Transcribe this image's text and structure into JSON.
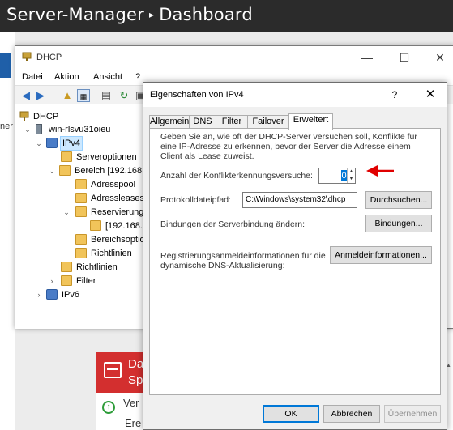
{
  "server_manager": {
    "title_app": "Server-Manager",
    "title_separator": "▸",
    "title_page": "Dashboard",
    "left_nav_fragment": "ner",
    "tile": {
      "header_line1": "Da",
      "header_line2": "Sp",
      "row1": "Ver",
      "row2": "Ere"
    }
  },
  "dhcp_window": {
    "title": "DHCP",
    "menu": [
      "Datei",
      "Aktion",
      "Ansicht",
      "?"
    ],
    "tree": [
      {
        "label": "DHCP"
      },
      {
        "label": "win-rlsvu31oieu"
      },
      {
        "label": "IPv4"
      },
      {
        "label": "Serveroptionen"
      },
      {
        "label": "Bereich [192.168."
      },
      {
        "label": "Adresspool"
      },
      {
        "label": "Adressleases"
      },
      {
        "label": "Reservierung"
      },
      {
        "label": "[192.168.2"
      },
      {
        "label": "Bereichsoptio"
      },
      {
        "label": "Richtlinien"
      },
      {
        "label": "Richtlinien"
      },
      {
        "label": "Filter"
      },
      {
        "label": "IPv6"
      }
    ]
  },
  "dialog": {
    "title": "Eigenschaften von IPv4",
    "help": "?",
    "close": "✕",
    "tabs": [
      "Allgemein",
      "DNS",
      "Filter",
      "Failover",
      "Erweitert"
    ],
    "active_tab": "Erweitert",
    "description": "Geben Sie an, wie oft der DHCP-Server versuchen soll, Konflikte für eine IP-Adresse zu erkennen, bevor der Server die Adresse einem Client als Lease zuweist.",
    "conflict_label": "Anzahl der Konflikterkennungsversuche:",
    "conflict_value": "0",
    "logpath_label": "Protokolldateipfad:",
    "logpath_value": "C:\\Windows\\system32\\dhcp",
    "browse_button": "Durchsuchen...",
    "bindings_label": "Bindungen der Serverbindung ändern:",
    "bindings_button": "Bindungen...",
    "dns_cred_label_line1": "Registrierungsanmeldeinformationen für die",
    "dns_cred_label_line2": "dynamische DNS-Aktualisierung:",
    "credentials_button": "Anmeldeinformationen...",
    "ok_button": "OK",
    "cancel_button": "Abbrechen",
    "apply_button": "Übernehmen"
  },
  "colors": {
    "annotation_arrow": "#e00000",
    "selection": "#0078d7",
    "tile_alert": "#d32f2f"
  }
}
